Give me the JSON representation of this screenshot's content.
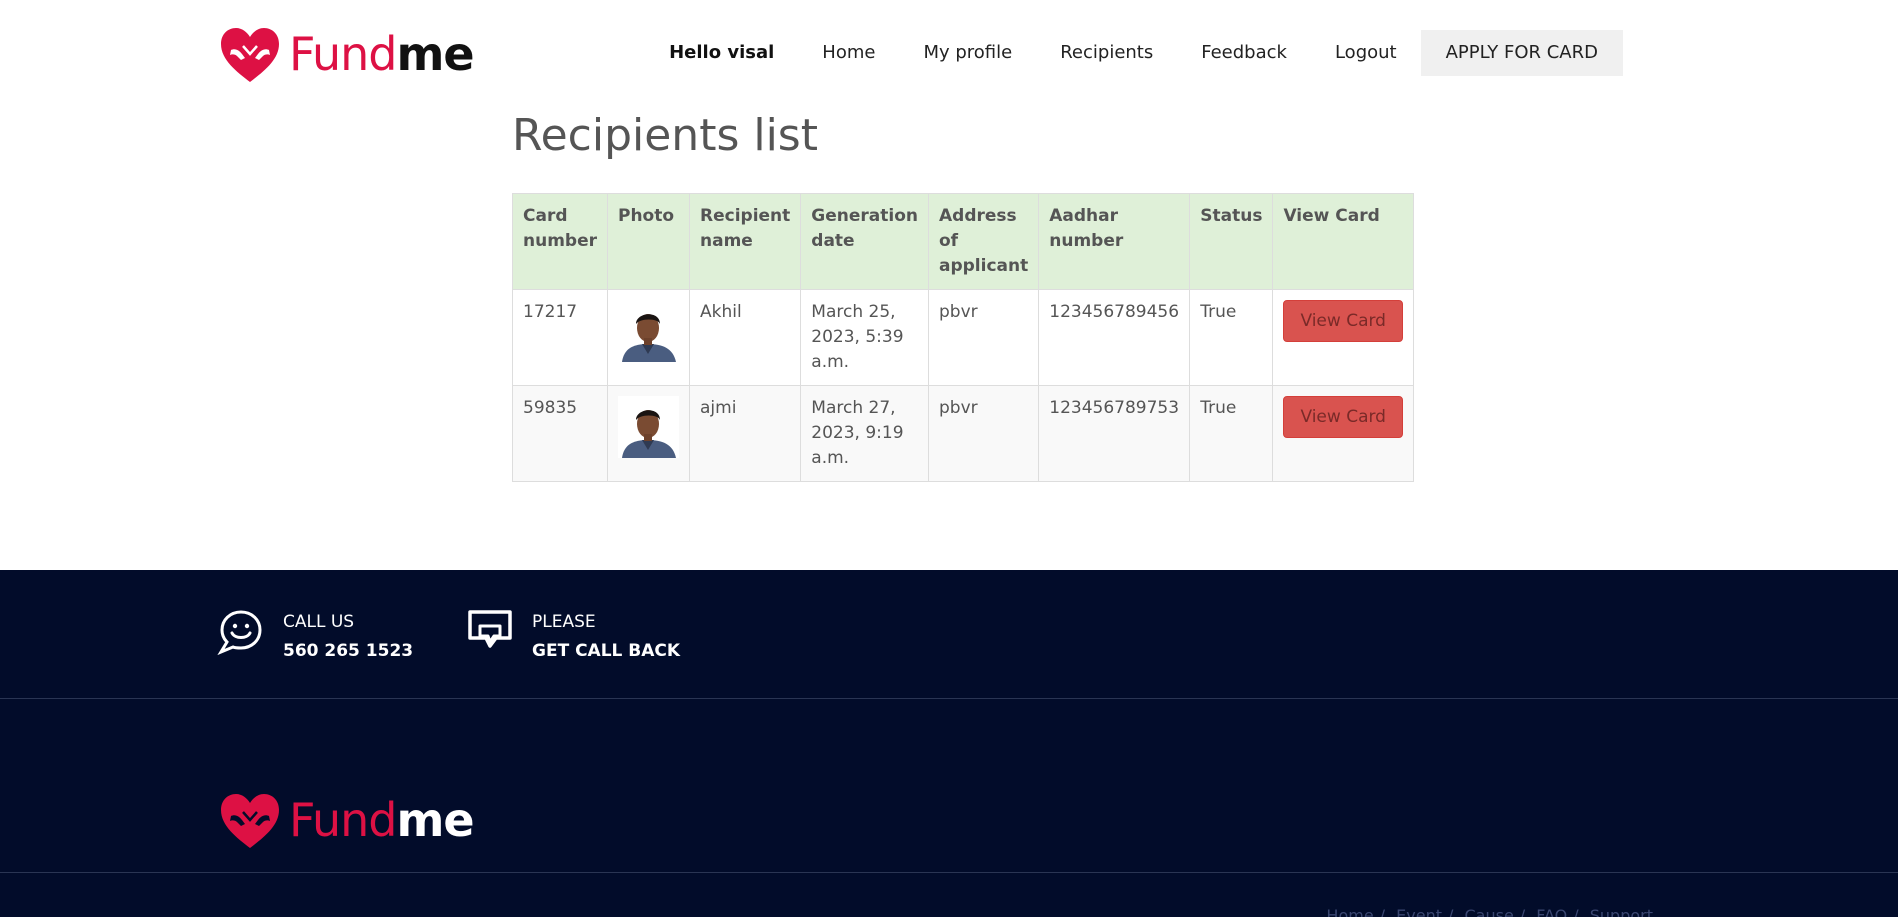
{
  "brand": {
    "part1": "Fund",
    "part2": "me",
    "accent": "#dd1144"
  },
  "nav": {
    "greeting": "Hello visal",
    "items": [
      {
        "label": "Home"
      },
      {
        "label": "My profile"
      },
      {
        "label": "Recipients"
      },
      {
        "label": "Feedback"
      },
      {
        "label": "Logout"
      }
    ],
    "apply": "APPLY FOR CARD"
  },
  "page": {
    "title": "Recipients list"
  },
  "table": {
    "headers": [
      "Card number",
      "Photo",
      "Recipient name",
      "Generation date",
      "Address of applicant",
      "Aadhar number",
      "Status",
      "View Card"
    ],
    "rows": [
      {
        "card_number": "17217",
        "photo": "recipient-photo",
        "name": "Akhil",
        "date": "March 25, 2023, 5:39 a.m.",
        "address": "pbvr",
        "aadhar": "123456789456",
        "status": "True",
        "action": "View Card"
      },
      {
        "card_number": "59835",
        "photo": "recipient-photo",
        "name": "ajmi",
        "date": "March 27, 2023, 9:19 a.m.",
        "address": "pbvr",
        "aadhar": "123456789753",
        "status": "True",
        "action": "View Card"
      }
    ],
    "header_bg": "#dff0d8",
    "button_color": "#d9534f"
  },
  "footer": {
    "bg": "#020c2a",
    "call": {
      "line1": "CALL US",
      "line2": "560 265 1523",
      "icon": "smiley-chat-icon"
    },
    "callback": {
      "line1": "PLEASE",
      "line2": "GET CALL BACK",
      "icon": "chat-bubble-icon"
    },
    "links": [
      "Home",
      "Event",
      "Cause",
      "FAQ",
      "Support"
    ]
  }
}
